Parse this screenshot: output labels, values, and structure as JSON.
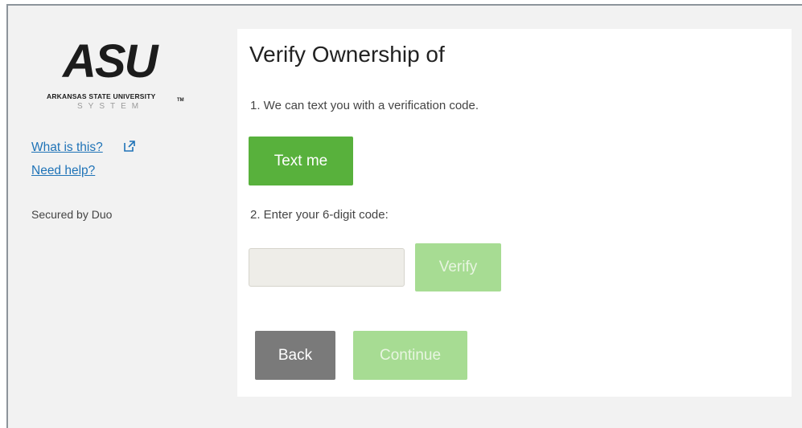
{
  "sidebar": {
    "logo": {
      "mark": "ASU",
      "tm": "TM",
      "university": "ARKANSAS STATE UNIVERSITY",
      "system": "SYSTEM"
    },
    "what_is_this": "What is this?",
    "need_help": "Need help?",
    "secured_by": "Secured by Duo"
  },
  "main": {
    "title": "Verify Ownership of",
    "step1_text": "1. We can text you with a verification code.",
    "text_me_label": "Text me",
    "step2_text": "2. Enter your 6-digit code:",
    "code_input_value": "",
    "verify_label": "Verify",
    "back_label": "Back",
    "continue_label": "Continue"
  },
  "colors": {
    "primary_green": "#58b13c",
    "disabled_green": "#a7dc93",
    "back_gray": "#7a7a7a",
    "link_blue": "#1f73b7"
  },
  "icons": {
    "external_link": "external-link-icon"
  }
}
